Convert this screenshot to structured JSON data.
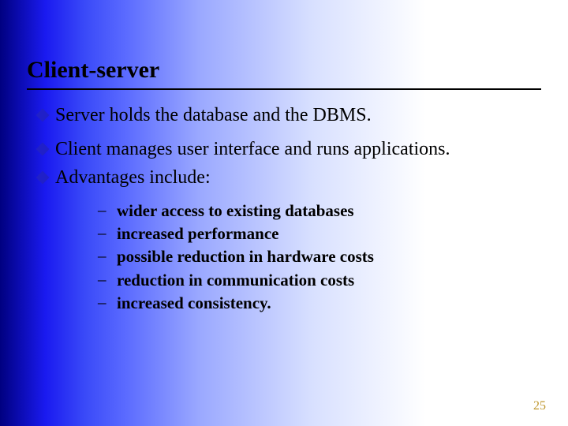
{
  "title": "Client-server",
  "bullets": [
    {
      "text": "Server holds the database and the DBMS."
    },
    {
      "text": "Client manages user interface and runs applications."
    },
    {
      "text": "Advantages include:"
    }
  ],
  "sub_bullets": [
    "wider access to existing databases",
    "increased performance",
    "possible reduction in hardware costs",
    "reduction in communication costs",
    "increased consistency."
  ],
  "page_number": "25"
}
